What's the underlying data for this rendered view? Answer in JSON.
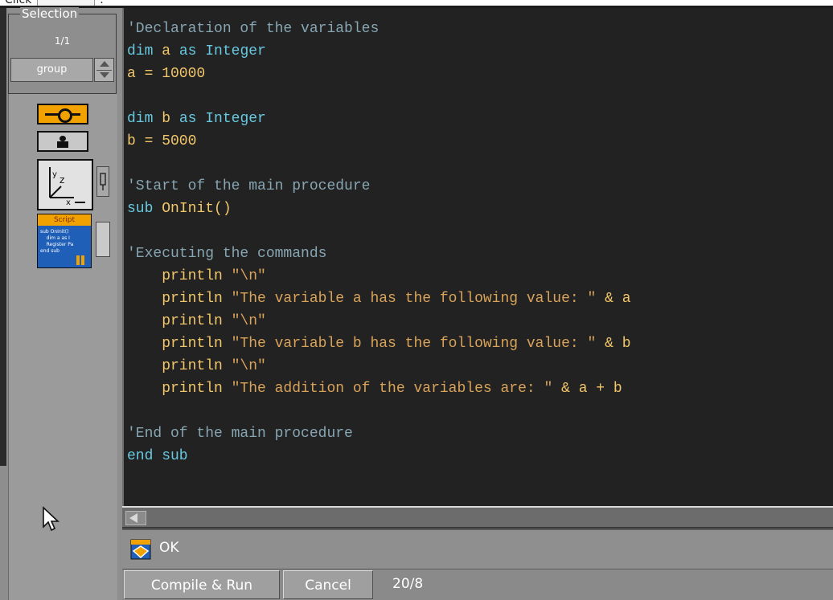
{
  "top_fragment": {
    "text": "Click",
    "tail": "."
  },
  "selection": {
    "title": "Selection",
    "count": "1/1",
    "group_value": "group"
  },
  "tools": {
    "link_icon": "link-toggle-icon",
    "person_icon": "person-icon",
    "axis_icon": "axis-xyz-icon",
    "lock_icon": "lock-icon",
    "script": {
      "tab_label": "Script",
      "preview_text": "sub OnInit()\n    dim a as I\n    Register Pa\nend sub"
    }
  },
  "editor": {
    "lines": [
      {
        "segments": [
          {
            "cls": "c-comment",
            "text": "'Declaration of the variables"
          }
        ]
      },
      {
        "segments": [
          {
            "cls": "c-kw",
            "text": "dim "
          },
          {
            "cls": "c-id",
            "text": "a"
          },
          {
            "cls": "c-kw",
            "text": " as Integer"
          }
        ]
      },
      {
        "segments": [
          {
            "cls": "c-id",
            "text": "a = 10000"
          }
        ]
      },
      {
        "segments": []
      },
      {
        "segments": [
          {
            "cls": "c-kw",
            "text": "dim "
          },
          {
            "cls": "c-id",
            "text": "b"
          },
          {
            "cls": "c-kw",
            "text": " as Integer"
          }
        ]
      },
      {
        "segments": [
          {
            "cls": "c-id",
            "text": "b = 5000"
          }
        ]
      },
      {
        "segments": []
      },
      {
        "segments": [
          {
            "cls": "c-comment",
            "text": "'Start of the main procedure"
          }
        ]
      },
      {
        "segments": [
          {
            "cls": "c-kw",
            "text": "sub "
          },
          {
            "cls": "c-id",
            "text": "OnInit()"
          }
        ]
      },
      {
        "segments": []
      },
      {
        "segments": [
          {
            "cls": "c-comment",
            "text": "'Executing the commands"
          }
        ]
      },
      {
        "segments": [
          {
            "cls": "c-id",
            "text": "    println "
          },
          {
            "cls": "c-str",
            "text": "\"\\n\""
          }
        ]
      },
      {
        "segments": [
          {
            "cls": "c-id",
            "text": "    println "
          },
          {
            "cls": "c-str",
            "text": "\"The variable a has the following value: \""
          },
          {
            "cls": "c-id",
            "text": " & a"
          }
        ]
      },
      {
        "segments": [
          {
            "cls": "c-id",
            "text": "    println "
          },
          {
            "cls": "c-str",
            "text": "\"\\n\""
          }
        ]
      },
      {
        "segments": [
          {
            "cls": "c-id",
            "text": "    println "
          },
          {
            "cls": "c-str",
            "text": "\"The variable b has the following value: \""
          },
          {
            "cls": "c-id",
            "text": " & b"
          }
        ]
      },
      {
        "segments": [
          {
            "cls": "c-id",
            "text": "    println "
          },
          {
            "cls": "c-str",
            "text": "\"\\n\""
          }
        ]
      },
      {
        "segments": [
          {
            "cls": "c-id",
            "text": "    println "
          },
          {
            "cls": "c-str",
            "text": "\"The addition of the variables are: \""
          },
          {
            "cls": "c-id",
            "text": " & a + b"
          }
        ]
      },
      {
        "segments": []
      },
      {
        "segments": [
          {
            "cls": "c-comment",
            "text": "'End of the main procedure"
          }
        ]
      },
      {
        "segments": [
          {
            "cls": "c-kw",
            "text": "end sub"
          }
        ]
      }
    ]
  },
  "status": {
    "icon": "script-status-icon",
    "text": "OK"
  },
  "footer": {
    "compile_label": "Compile & Run",
    "cancel_label": "Cancel",
    "cursor_position": "20/8"
  },
  "colors": {
    "editor_bg": "#222222",
    "comment": "#87a5b2",
    "keyword": "#68c8e0",
    "identifier": "#f2c66a",
    "string": "#d9a35a",
    "accent_orange": "#f1a100",
    "panel_grey": "#8e8e8e"
  }
}
